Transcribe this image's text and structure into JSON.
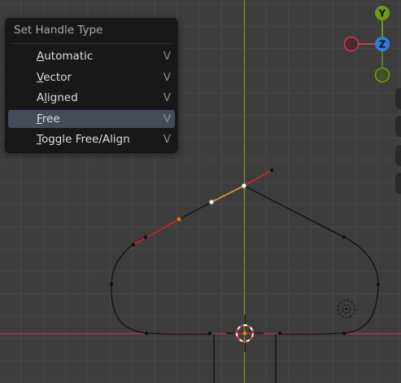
{
  "menu": {
    "title": "Set Handle Type",
    "items": [
      {
        "prefix": "",
        "key": "A",
        "rest": "utomatic",
        "shortcut": "V",
        "active": false
      },
      {
        "prefix": "",
        "key": "V",
        "rest": "ector",
        "shortcut": "V",
        "active": false
      },
      {
        "prefix": "A",
        "key": "l",
        "rest": "igned",
        "shortcut": "V",
        "active": false
      },
      {
        "prefix": "",
        "key": "F",
        "rest": "ree",
        "shortcut": "V",
        "active": true
      },
      {
        "prefix": "",
        "key": "T",
        "rest": "oggle Free/Align",
        "shortcut": "V",
        "active": false
      }
    ]
  },
  "gizmo": {
    "y_label": "Y",
    "z_label": "Z",
    "y_color": "#6e9a14",
    "z_color": "#2f7fe0",
    "x_color": "#c43a4a",
    "y_neg_color": "#5d7a2a",
    "x_neg_color": "#c43a4a"
  },
  "colors": {
    "x_axis": "#b03a48",
    "y_axis": "#7b9a18",
    "curve": "#101010",
    "handle_free": "#c22a2a",
    "handle_aligned": "#c9a136",
    "selected_point": "#ffffff",
    "cursor_ring": "#c84a48"
  }
}
